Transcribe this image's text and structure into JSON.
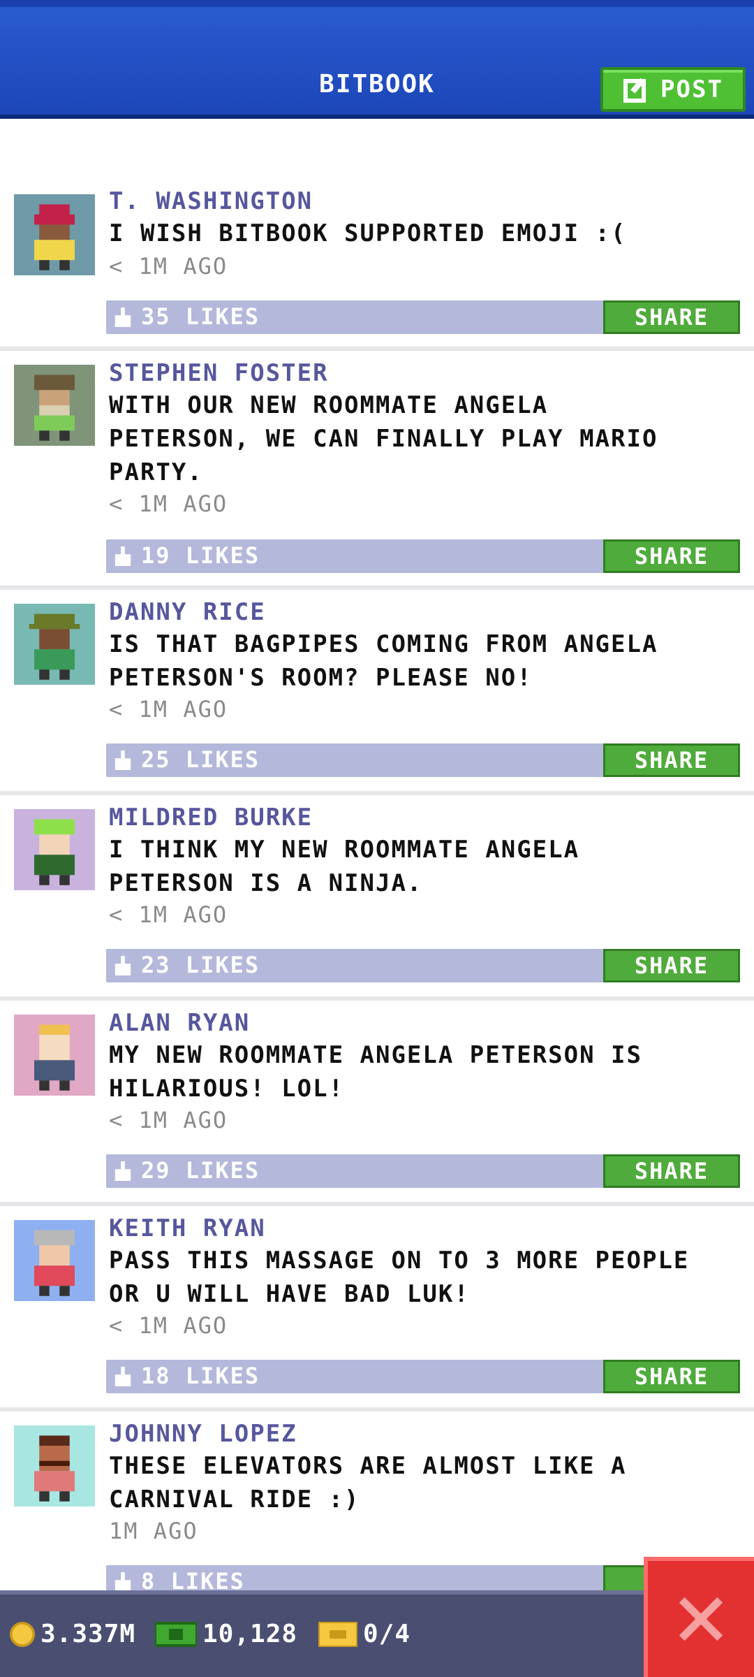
{
  "header": {
    "title": "BITBOOK",
    "post_label": "POST"
  },
  "posts": [
    {
      "author": "T. WASHINGTON",
      "message": "I WISH BITBOOK SUPPORTED EMOJI :(",
      "time": "< 1M AGO",
      "likes": "35 LIKES",
      "share": "SHARE",
      "avatar_bg": "#6f9aa8"
    },
    {
      "author": "STEPHEN FOSTER",
      "message": "WITH OUR NEW ROOMMATE ANGELA\nPETERSON, WE CAN FINALLY PLAY MARIO\nPARTY.",
      "time": "< 1M AGO",
      "likes": "19 LIKES",
      "share": "SHARE",
      "avatar_bg": "#7f9478"
    },
    {
      "author": "DANNY RICE",
      "message": "IS THAT BAGPIPES COMING FROM ANGELA\nPETERSON'S ROOM? PLEASE NO!",
      "time": "< 1M AGO",
      "likes": "25 LIKES",
      "share": "SHARE",
      "avatar_bg": "#79b9b4"
    },
    {
      "author": "MILDRED BURKE",
      "message": "I THINK MY NEW ROOMMATE ANGELA\nPETERSON IS A NINJA.",
      "time": "< 1M AGO",
      "likes": "23 LIKES",
      "share": "SHARE",
      "avatar_bg": "#c9b2dd"
    },
    {
      "author": "ALAN RYAN",
      "message": "MY NEW ROOMMATE ANGELA PETERSON IS\nHILARIOUS! LOL!",
      "time": "< 1M AGO",
      "likes": "29 LIKES",
      "share": "SHARE",
      "avatar_bg": "#e0a8c4"
    },
    {
      "author": "KEITH RYAN",
      "message": "PASS THIS MASSAGE ON TO 3 MORE PEOPLE\nOR U WILL HAVE BAD LUK!",
      "time": "< 1M AGO",
      "likes": "18 LIKES",
      "share": "SHARE",
      "avatar_bg": "#8fb0f0"
    },
    {
      "author": "JOHNNY LOPEZ",
      "message": "THESE ELEVATORS ARE ALMOST LIKE A\nCARNIVAL RIDE :)",
      "time": "1M AGO",
      "likes": "8 LIKES",
      "share": "S",
      "avatar_bg": "#a8e6e2"
    }
  ],
  "status_bar": {
    "coins": "3.337M",
    "bux": "10,128",
    "tickets": "0/4"
  },
  "colors": {
    "header_blue": "#1c46b8",
    "post_green": "#4fc034",
    "author_purple": "#57579e",
    "like_bar": "#b4b8da",
    "close_red": "#e33030"
  }
}
